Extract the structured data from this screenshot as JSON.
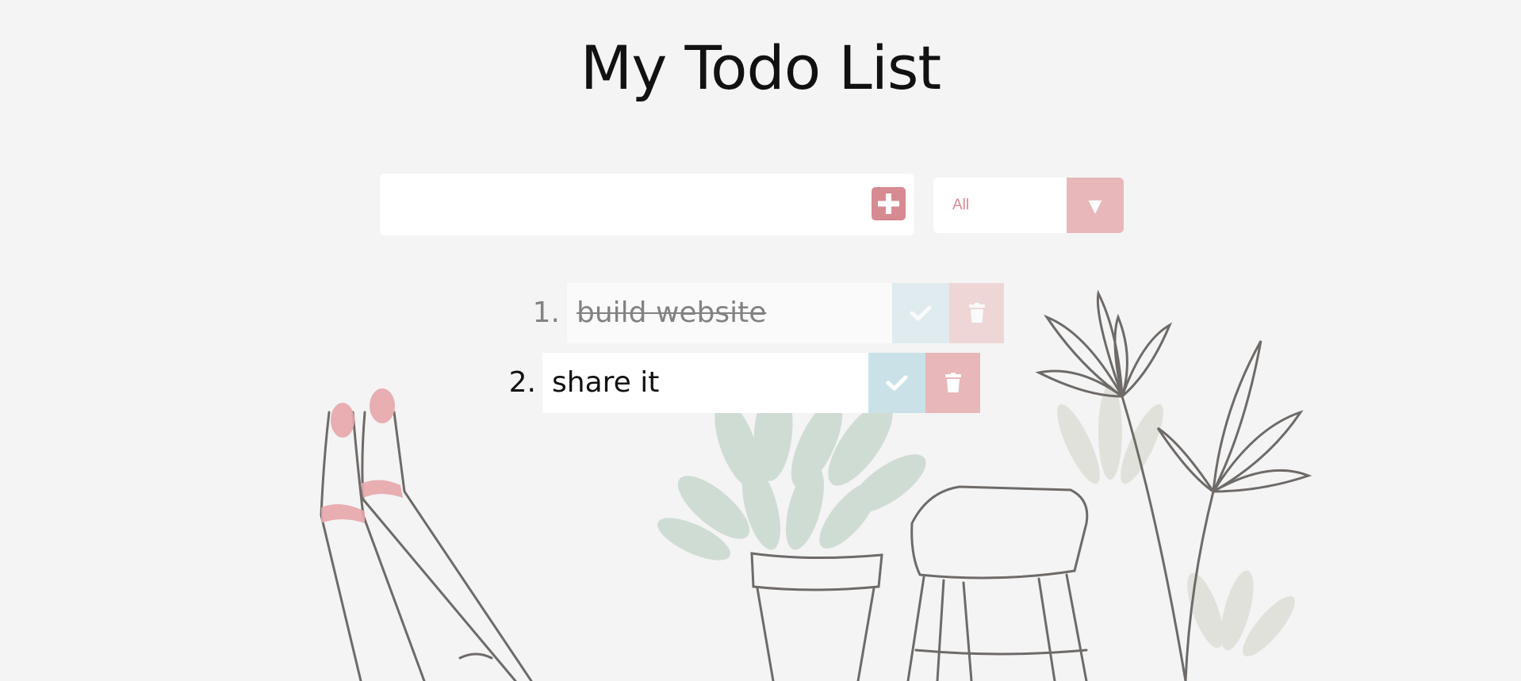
{
  "page": {
    "title": "My Todo List"
  },
  "form": {
    "input_value": "",
    "add_icon": "plus-icon"
  },
  "filter": {
    "selected": "All",
    "arrow": "▼"
  },
  "todos": [
    {
      "number": "1.",
      "text": "build website",
      "completed": true
    },
    {
      "number": "2.",
      "text": "share it",
      "completed": false
    }
  ],
  "icons": {
    "complete": "check-icon",
    "delete": "trash-icon"
  },
  "colors": {
    "background": "#f4f4f4",
    "accent_pink": "#d68a92",
    "light_pink": "#e8b7b9",
    "light_blue": "#cae2e7",
    "text": "#111111"
  }
}
